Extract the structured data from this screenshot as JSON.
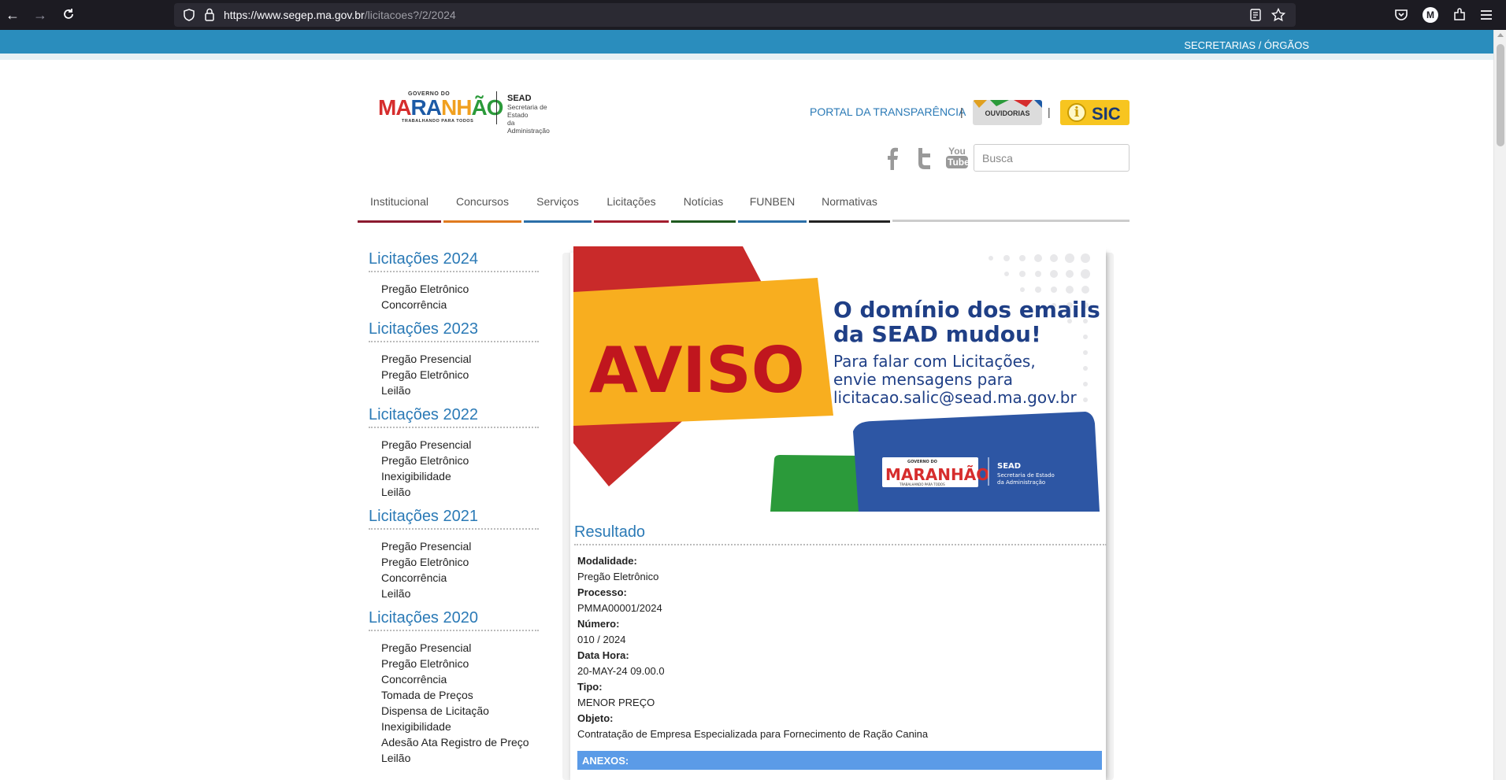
{
  "browser": {
    "url_host": "https://www.segep.ma.gov.br",
    "url_path": "/licitacoes?/2/2024",
    "profile_initial": "M"
  },
  "topbar": {
    "link": "SECRETARIAS / ÓRGÃOS",
    "color": "#2a8dbd"
  },
  "header": {
    "logo_top": "GOVERNO DO",
    "logo_main": "MARANHÃO",
    "logo_sub": "TRABALHANDO PARA TODOS",
    "sead_title": "SEAD",
    "sead_line1": "Secretaria de Estado",
    "sead_line2": "da Administração",
    "portal_link": "PORTAL DA TRANSPARÊNCIA",
    "separator": "|",
    "ouvidorias": "OUVIDORIAS",
    "sic": "SIC",
    "social": [
      "facebook-icon",
      "twitter-icon",
      "youtube-icon"
    ],
    "youtube_top": "You",
    "youtube_bottom": "Tube",
    "search_placeholder": "Busca"
  },
  "nav": [
    {
      "label": "Institucional",
      "color": "#8b1a2f"
    },
    {
      "label": "Concursos",
      "color": "#e07b1f"
    },
    {
      "label": "Serviços",
      "color": "#2b6fa8"
    },
    {
      "label": "Licitações",
      "color": "#a31d2e"
    },
    {
      "label": "Notícias",
      "color": "#1f5a1f"
    },
    {
      "label": "FUNBEN",
      "color": "#2b6fa8"
    },
    {
      "label": "Normativas",
      "color": "#222222"
    }
  ],
  "sidebar": [
    {
      "title": "Licitações 2024",
      "links": [
        "Pregão Eletrônico",
        "Concorrência"
      ]
    },
    {
      "title": "Licitações 2023",
      "links": [
        "Pregão Presencial",
        "Pregão Eletrônico",
        "Leilão"
      ]
    },
    {
      "title": "Licitações 2022",
      "links": [
        "Pregão Presencial",
        "Pregão Eletrônico",
        "Inexigibilidade",
        "Leilão"
      ]
    },
    {
      "title": "Licitações 2021",
      "links": [
        "Pregão Presencial",
        "Pregão Eletrônico",
        "Concorrência",
        "Leilão"
      ]
    },
    {
      "title": "Licitações 2020",
      "links": [
        "Pregão Presencial",
        "Pregão Eletrônico",
        "Concorrência",
        "Tomada de Preços",
        "Dispensa de Licitação",
        "Inexigibilidade",
        "Adesão Ata Registro de Preço",
        "Leilão"
      ]
    }
  ],
  "banner": {
    "aviso": "AVISO",
    "headline1": "O domínio dos emails",
    "headline2": "da SEAD mudou!",
    "body1": "Para falar com Licitações,",
    "body2": "envie mensagens para",
    "email": "licitacao.salic@sead.ma.gov.br",
    "logo_top": "GOVERNO DO",
    "logo_main": "MARANHÃO",
    "logo_sub": "TRABALHANDO PARA TODOS",
    "sead_title": "SEAD",
    "sead_line1": "Secretaria de Estado",
    "sead_line2": "da Administração"
  },
  "result": {
    "title": "Resultado",
    "modalidade_label": "Modalidade:",
    "modalidade": "Pregão Eletrônico",
    "processo_label": "Processo:",
    "processo": "PMMA00001/2024",
    "numero_label": "Número:",
    "numero": "010 / 2024",
    "datahora_label": "Data Hora:",
    "datahora": "20-MAY-24 09.00.0",
    "tipo_label": "Tipo:",
    "tipo": "MENOR PREÇO",
    "objeto_label": "Objeto:",
    "objeto": "Contratação de Empresa Especializada para Fornecimento de Ração Canina",
    "anexos": "ANEXOS:"
  }
}
